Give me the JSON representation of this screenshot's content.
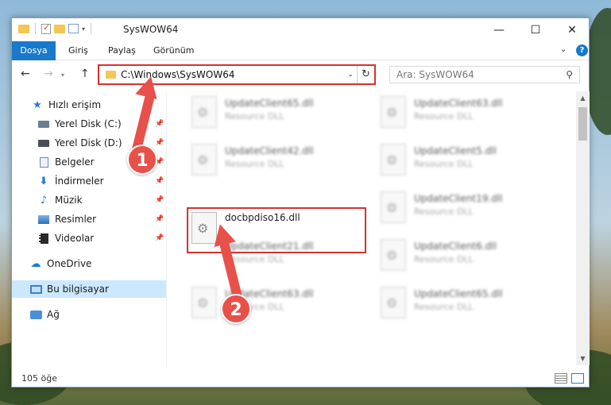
{
  "window": {
    "title": "SysWOW64",
    "minimize": "—",
    "maximize": "☐",
    "close": "✕"
  },
  "ribbon": {
    "tabs": [
      "Dosya",
      "Giriş",
      "Paylaş",
      "Görünüm"
    ],
    "help": "?"
  },
  "nav": {
    "address": "C:\\Windows\\SysWOW64",
    "search_placeholder": "Ara: SysWOW64"
  },
  "sidebar": {
    "items": [
      {
        "label": "Hızlı erişim",
        "icon": "star-icon",
        "pinned": false
      },
      {
        "label": "Yerel Disk (C:)",
        "icon": "drive-icon",
        "pinned": true
      },
      {
        "label": "Yerel Disk (D:)",
        "icon": "drive-icon",
        "pinned": true
      },
      {
        "label": "Belgeler",
        "icon": "documents-icon",
        "pinned": true
      },
      {
        "label": "İndirmeler",
        "icon": "download-icon",
        "pinned": true
      },
      {
        "label": "Müzik",
        "icon": "music-icon",
        "pinned": true
      },
      {
        "label": "Resimler",
        "icon": "pictures-icon",
        "pinned": true
      },
      {
        "label": "Videolar",
        "icon": "videos-icon",
        "pinned": true
      },
      {
        "label": "OneDrive",
        "icon": "cloud-icon",
        "pinned": false
      },
      {
        "label": "Bu bilgisayar",
        "icon": "computer-icon",
        "pinned": false,
        "selected": true
      },
      {
        "label": "Ağ",
        "icon": "network-icon",
        "pinned": false
      }
    ]
  },
  "files": [
    {
      "name": "UpdateClient65.dll",
      "desc": "Resource DLL",
      "blurred": true
    },
    {
      "name": "UpdateClient63.dll",
      "desc": "Resource DLL",
      "blurred": true
    },
    {
      "name": "UpdateClient42.dll",
      "desc": "Resource DLL",
      "blurred": true
    },
    {
      "name": "UpdateClient5.dll",
      "desc": "Resource DLL",
      "blurred": true
    },
    {
      "name": "docbpdiso16.dll",
      "desc": "",
      "blurred": false,
      "highlighted": true
    },
    {
      "name": "UpdateClient19.dll",
      "desc": "Resource DLL",
      "blurred": true
    },
    {
      "name": "UpdateClient21.dll",
      "desc": "Resource DLL",
      "blurred": true
    },
    {
      "name": "UpdateClient6.dll",
      "desc": "Resource DLL",
      "blurred": true
    },
    {
      "name": "UpdateClient63.dll",
      "desc": "Resource DLL",
      "blurred": true
    },
    {
      "name": "UpdateClient65.dll",
      "desc": "Resource DLL",
      "blurred": true
    }
  ],
  "status": {
    "item_count": "105 öğe"
  },
  "annotations": {
    "step1": "1",
    "step2": "2",
    "accent_color": "#e8504a"
  },
  "colors": {
    "accent": "#1979ca",
    "highlight_border": "#d8302f",
    "selected_bg": "#cce8ff"
  }
}
